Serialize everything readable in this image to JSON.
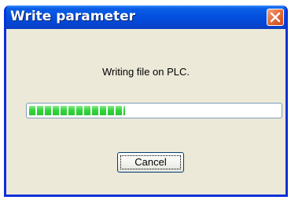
{
  "dialog": {
    "title": "Write parameter",
    "message": "Writing file on PLC.",
    "progress": {
      "value_fraction": 0.385,
      "color": "#31d63a"
    },
    "cancel_label": "Cancel"
  },
  "colors": {
    "titlebar": "#0552e0",
    "frame": "#0831d9",
    "body": "#ece9d8",
    "close_button": "#e5703f"
  },
  "icons": {
    "close": "close-icon"
  }
}
